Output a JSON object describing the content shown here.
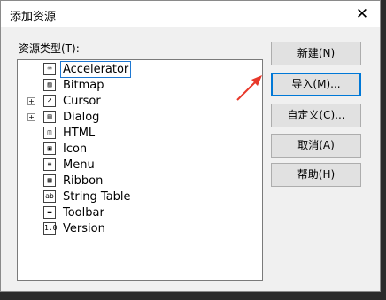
{
  "dialog": {
    "title": "添加资源",
    "close_glyph": "✕",
    "type_label": "资源类型(T):"
  },
  "resource_types": [
    {
      "label": "Accelerator",
      "icon": "accelerator-icon",
      "expandable": false,
      "selected": true
    },
    {
      "label": "Bitmap",
      "icon": "bitmap-icon",
      "expandable": false,
      "selected": false
    },
    {
      "label": "Cursor",
      "icon": "cursor-icon",
      "expandable": true,
      "selected": false
    },
    {
      "label": "Dialog",
      "icon": "dialog-icon",
      "expandable": true,
      "selected": false
    },
    {
      "label": "HTML",
      "icon": "html-icon",
      "expandable": false,
      "selected": false
    },
    {
      "label": "Icon",
      "icon": "icon-icon",
      "expandable": false,
      "selected": false
    },
    {
      "label": "Menu",
      "icon": "menu-icon",
      "expandable": false,
      "selected": false
    },
    {
      "label": "Ribbon",
      "icon": "ribbon-icon",
      "expandable": false,
      "selected": false
    },
    {
      "label": "String Table",
      "icon": "string-table-icon",
      "expandable": false,
      "selected": false
    },
    {
      "label": "Toolbar",
      "icon": "toolbar-icon",
      "expandable": false,
      "selected": false
    },
    {
      "label": "Version",
      "icon": "version-icon",
      "expandable": false,
      "selected": false
    }
  ],
  "buttons": {
    "new": "新建(N)",
    "import": "导入(M)...",
    "custom": "自定义(C)...",
    "cancel": "取消(A)",
    "help": "帮助(H)"
  },
  "colors": {
    "annotation_arrow": "#e8382a",
    "focus_border": "#0078d7"
  }
}
